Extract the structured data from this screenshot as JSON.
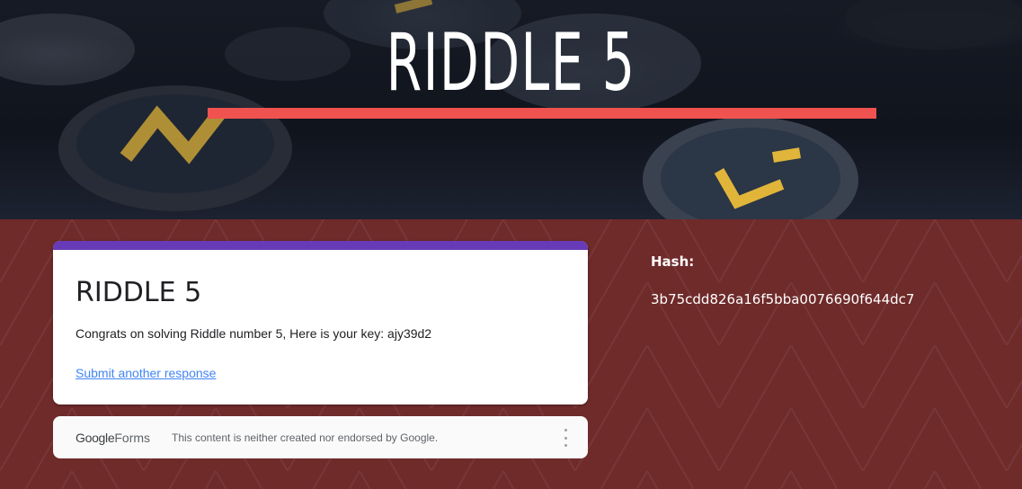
{
  "header": {
    "title": "RIDDLE 5"
  },
  "form": {
    "title": "RIDDLE 5",
    "message": "Congrats on solving Riddle number 5, Here is your key: ajy39d2",
    "submit_another_label": "Submit another response"
  },
  "footer": {
    "brand_google": "Google",
    "brand_forms": "Forms",
    "disclaimer": "This content is neither created nor endorsed by Google.",
    "menu_icon": "more-vert-icon"
  },
  "side": {
    "hash_label": "Hash:",
    "hash_value": "3b75cdd826a16f5bba0076690f644dc7"
  },
  "colors": {
    "accent_underline": "#f0524f",
    "form_theme": "#673ab7",
    "background": "#6f2a2a",
    "link": "#4285f4"
  }
}
